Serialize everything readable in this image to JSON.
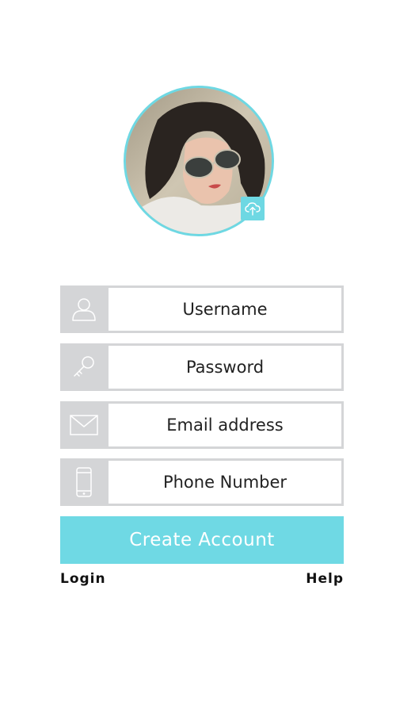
{
  "profile": {
    "avatar_icon": "profile-photo",
    "upload_icon": "cloud-upload-icon",
    "accent_color": "#6ed8e3"
  },
  "form": {
    "fields": [
      {
        "icon": "user-icon",
        "placeholder": "Username",
        "value": ""
      },
      {
        "icon": "key-icon",
        "placeholder": "Password",
        "value": ""
      },
      {
        "icon": "envelope-icon",
        "placeholder": "Email address",
        "value": ""
      },
      {
        "icon": "phone-icon",
        "placeholder": "Phone Number",
        "value": ""
      }
    ],
    "submit_label": "Create Account",
    "field_bg_color": "#d4d5d7",
    "button_color": "#6fd9e4"
  },
  "footer": {
    "login_label": "Login",
    "help_label": "Help"
  }
}
